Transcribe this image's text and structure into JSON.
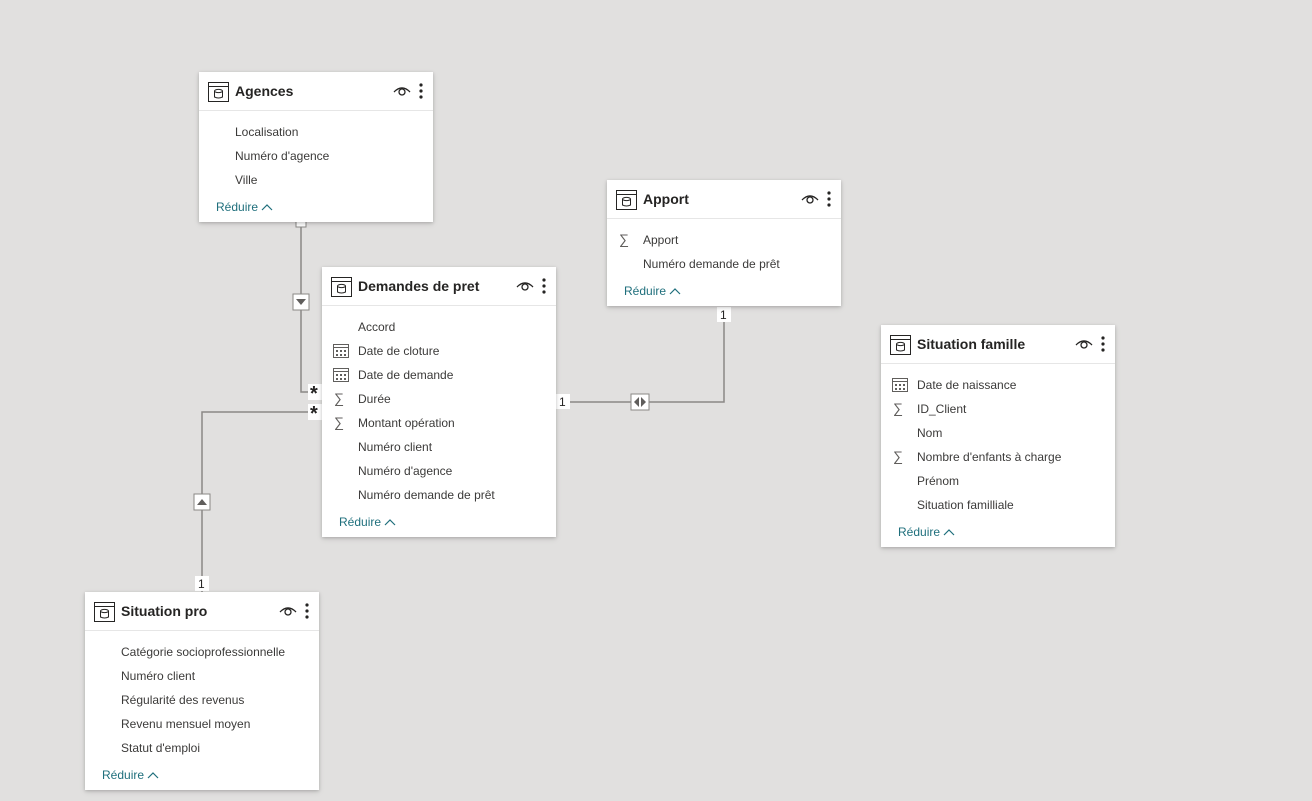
{
  "tables": {
    "agences": {
      "name": "Agences",
      "fields": [
        {
          "label": "Localisation",
          "icon": "none"
        },
        {
          "label": "Numéro d'agence",
          "icon": "none"
        },
        {
          "label": "Ville",
          "icon": "none"
        }
      ],
      "collapse_label": "Réduire"
    },
    "apport": {
      "name": "Apport",
      "fields": [
        {
          "label": "Apport",
          "icon": "sigma"
        },
        {
          "label": "Numéro demande de prêt",
          "icon": "none"
        }
      ],
      "collapse_label": "Réduire"
    },
    "demandes": {
      "name": "Demandes de pret",
      "fields": [
        {
          "label": "Accord",
          "icon": "none"
        },
        {
          "label": "Date de cloture",
          "icon": "calendar"
        },
        {
          "label": "Date de demande",
          "icon": "calendar"
        },
        {
          "label": "Durée",
          "icon": "sigma"
        },
        {
          "label": "Montant opération",
          "icon": "sigma"
        },
        {
          "label": "Numéro client",
          "icon": "none"
        },
        {
          "label": "Numéro d'agence",
          "icon": "none"
        },
        {
          "label": "Numéro demande de prêt",
          "icon": "none"
        }
      ],
      "collapse_label": "Réduire"
    },
    "famille": {
      "name": "Situation famille",
      "fields": [
        {
          "label": "Date de naissance",
          "icon": "calendar"
        },
        {
          "label": "ID_Client",
          "icon": "sigma"
        },
        {
          "label": "Nom",
          "icon": "none"
        },
        {
          "label": "Nombre d'enfants à charge",
          "icon": "sigma"
        },
        {
          "label": "Prénom",
          "icon": "none"
        },
        {
          "label": "Situation familliale",
          "icon": "none"
        }
      ],
      "collapse_label": "Réduire"
    },
    "pro": {
      "name": "Situation pro",
      "fields": [
        {
          "label": "Catégorie socioprofessionnelle",
          "icon": "none"
        },
        {
          "label": "Numéro client",
          "icon": "none"
        },
        {
          "label": "Régularité des revenus",
          "icon": "none"
        },
        {
          "label": "Revenu mensuel moyen",
          "icon": "none"
        },
        {
          "label": "Statut d'emploi",
          "icon": "none"
        }
      ],
      "collapse_label": "Réduire"
    }
  },
  "relationships": [
    {
      "from": "Agences",
      "to": "Demandes de pret",
      "from_card": "1",
      "to_card": "*",
      "direction": "single"
    },
    {
      "from": "Situation pro",
      "to": "Demandes de pret",
      "from_card": "1",
      "to_card": "*",
      "direction": "single"
    },
    {
      "from": "Apport",
      "to": "Demandes de pret",
      "from_card": "1",
      "to_card": "1",
      "direction": "both"
    }
  ],
  "colors": {
    "canvas": "#e1e0df",
    "card": "#ffffff",
    "line": "#8a8886",
    "link": "#1f6f7c",
    "text": "#252423"
  }
}
